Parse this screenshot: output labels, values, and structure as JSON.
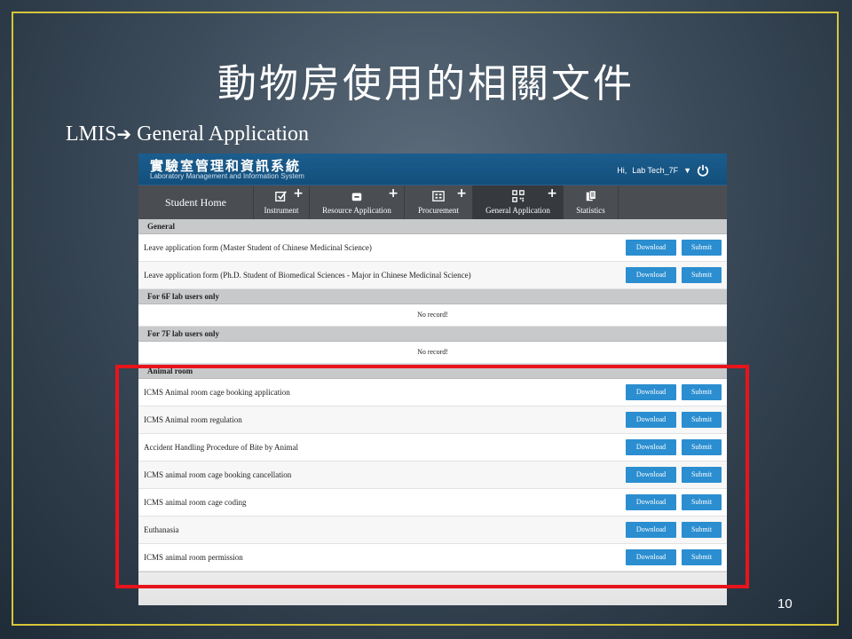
{
  "slide": {
    "title": "動物房使用的相關文件",
    "subtitle": "LMIS",
    "subtitle_arrow": "➔",
    "subtitle_rest": " General Application",
    "page_number": "10",
    "border_color": "#d8c53a",
    "highlight_color": "#e8141b"
  },
  "app": {
    "title_zh": "實驗室管理和資訊系統",
    "title_en": "Laboratory Management and Information System",
    "user_greeting": "Hi,",
    "user_name": "Lab Tech_7F",
    "nav": {
      "home": "Student Home",
      "instrument": "Instrument",
      "resource": "Resource Application",
      "procurement": "Procurement",
      "general": "General Application",
      "statistics": "Statistics"
    },
    "buttons": {
      "download": "Download",
      "submit": "Submit"
    },
    "sections": {
      "general": {
        "title": "General",
        "items": [
          "Leave application form (Master Student of Chinese Medicinal Science)",
          "Leave application form (Ph.D. Student of Biomedical Sciences - Major in Chinese Medicinal Science)"
        ]
      },
      "lab6f": {
        "title": "For 6F lab users only",
        "empty": "No record!"
      },
      "lab7f": {
        "title": "For 7F lab users only",
        "empty": "No record!"
      },
      "animal": {
        "title": "Animal room",
        "items": [
          "ICMS Animal room cage booking application",
          "ICMS Animal room regulation",
          "Accident Handling Procedure of Bite by Animal",
          "ICMS animal room cage booking cancellation",
          "ICMS animal room cage coding",
          "Euthanasia",
          "ICMS animal room permission"
        ]
      }
    }
  }
}
